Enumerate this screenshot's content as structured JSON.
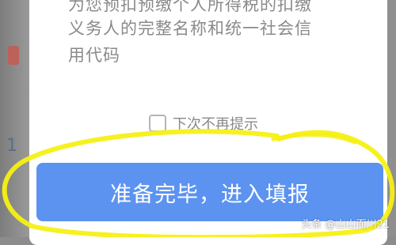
{
  "dialog": {
    "body_text_top_partial": "为您预扣预缴个人所得税的扣缴",
    "body_text_line2": "义务人的完整名称和统一社会信",
    "body_text_line3": "用代码",
    "checkbox_label": "下次不再提示",
    "primary_button_label": "准备完毕，进入填报"
  },
  "background": {
    "left_partial_digit": "1"
  },
  "watermark": {
    "text": "头条 @山山而川21"
  },
  "colors": {
    "primary_button": "#5c93f0",
    "highlight_circle": "#f5f014",
    "body_text": "#8a8a8a"
  }
}
